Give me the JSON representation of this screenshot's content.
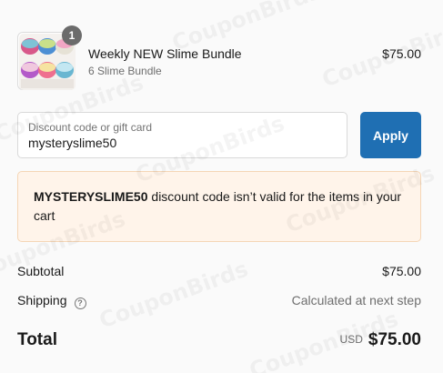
{
  "line_item": {
    "quantity": "1",
    "title": "Weekly NEW Slime Bundle",
    "subtitle": "6 Slime Bundle",
    "price": "$75.00"
  },
  "discount": {
    "label": "Discount code or gift card",
    "value": "mysteryslime50",
    "apply_label": "Apply"
  },
  "error": {
    "code": "MYSTERYSLIME50",
    "message": " discount code isn’t valid for the items in your cart"
  },
  "summary": {
    "subtotal_label": "Subtotal",
    "subtotal_value": "$75.00",
    "shipping_label": "Shipping",
    "shipping_help_icon": "?",
    "shipping_value": "Calculated at next step",
    "total_label": "Total",
    "total_currency": "USD",
    "total_value": "$75.00"
  },
  "watermark": "CouponBirds",
  "colors": {
    "accent": "#1f6fb3",
    "error_bg": "#fff4ea",
    "error_border": "#f5d6b6",
    "badge": "#6b6b6b"
  }
}
